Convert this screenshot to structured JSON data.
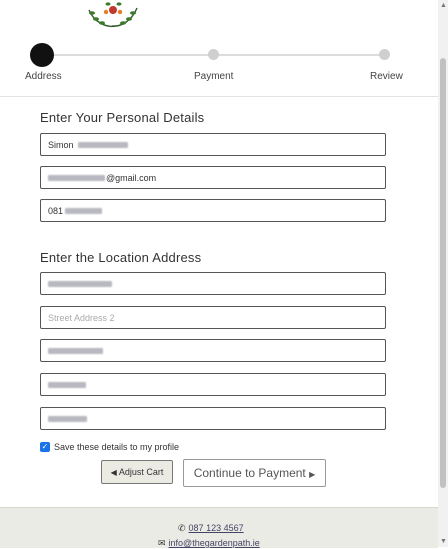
{
  "stepper": {
    "steps": [
      "Address",
      "Payment",
      "Review"
    ],
    "active_index": 0
  },
  "personal": {
    "title": "Enter Your Personal Details",
    "name_visible": "Simon",
    "email_suffix": "@gmail.com",
    "phone_prefix": "081"
  },
  "location": {
    "title": "Enter the Location Address",
    "street2_placeholder": "Street Address 2"
  },
  "save_details_label": "Save these details to my profile",
  "save_details_checked": true,
  "buttons": {
    "adjust_cart": "Adjust Cart",
    "continue": "Continue to Payment"
  },
  "footer": {
    "phone": "087 123 4567",
    "email": "info@thegardenpath.ie"
  },
  "colors": {
    "checkbox": "#1a73e8",
    "footer_bg": "#ebebe5",
    "adjust_button_bg": "#ecebe3"
  }
}
